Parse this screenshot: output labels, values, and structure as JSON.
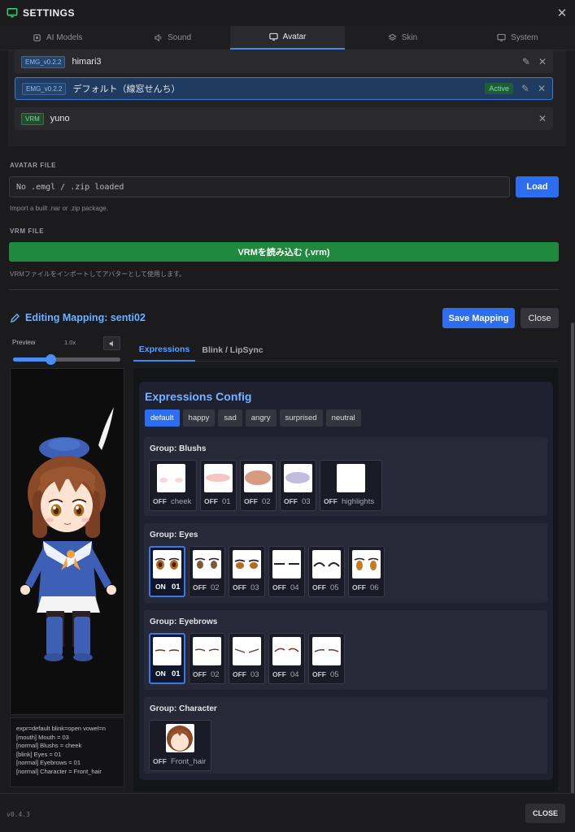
{
  "window": {
    "title": "SETTINGS"
  },
  "tabs": [
    {
      "label": "AI Models",
      "icon": "chip-icon"
    },
    {
      "label": "Sound",
      "icon": "speaker-icon"
    },
    {
      "label": "Avatar",
      "icon": "monitor-icon",
      "active": true
    },
    {
      "label": "Skin",
      "icon": "layers-icon"
    },
    {
      "label": "System",
      "icon": "monitor-icon"
    }
  ],
  "avatars": [
    {
      "badge": "EMG_v0.2.2",
      "name": "himari3"
    },
    {
      "badge": "EMG_v0.2.2",
      "name": "デフォルト（線窓せんち）",
      "status": "Active"
    },
    {
      "badge": "VRM",
      "name": "yuno"
    }
  ],
  "avatar_file": {
    "label": "AVATAR FILE",
    "placeholder": "No .emgl / .zip loaded",
    "load_label": "Load",
    "hint": "Import a built .nar or .zip package."
  },
  "vrm_file": {
    "label": "VRM FILE",
    "button_label": "VRMを読み込む (.vrm)",
    "hint": "VRMファイルをインポートしてアバターとして使用します。"
  },
  "editing": {
    "title": "Editing Mapping: senti02",
    "save_label": "Save Mapping",
    "close_label": "Close"
  },
  "preview": {
    "label": "Preview",
    "speed": "1.0x",
    "slider_value": 0.35,
    "debug_lines": [
      "expr=default blink=open vowel=n",
      "[mouth] Mouth = 03",
      "[normal] Blushs = cheek",
      "[blink] Eyes = 01",
      "[normal] Eyebrows = 01",
      "[normal] Character = Front_hair"
    ]
  },
  "subtabs": [
    {
      "label": "Expressions",
      "active": true
    },
    {
      "label": "Blink / LipSync"
    }
  ],
  "expressions": {
    "title": "Expressions Config",
    "presets": [
      {
        "label": "default",
        "active": true
      },
      {
        "label": "happy"
      },
      {
        "label": "sad"
      },
      {
        "label": "angry"
      },
      {
        "label": "surprised"
      },
      {
        "label": "neutral"
      }
    ],
    "groups": [
      {
        "title": "Group: Blushs",
        "items": [
          {
            "state": "OFF",
            "name": "cheek"
          },
          {
            "state": "OFF",
            "name": "01"
          },
          {
            "state": "OFF",
            "name": "02"
          },
          {
            "state": "OFF",
            "name": "03"
          },
          {
            "state": "OFF",
            "name": "highlights"
          }
        ]
      },
      {
        "title": "Group: Eyes",
        "items": [
          {
            "state": "ON",
            "name": "01"
          },
          {
            "state": "OFF",
            "name": "02"
          },
          {
            "state": "OFF",
            "name": "03"
          },
          {
            "state": "OFF",
            "name": "04"
          },
          {
            "state": "OFF",
            "name": "05"
          },
          {
            "state": "OFF",
            "name": "06"
          }
        ]
      },
      {
        "title": "Group: Eyebrows",
        "items": [
          {
            "state": "ON",
            "name": "01"
          },
          {
            "state": "OFF",
            "name": "02"
          },
          {
            "state": "OFF",
            "name": "03"
          },
          {
            "state": "OFF",
            "name": "04"
          },
          {
            "state": "OFF",
            "name": "05"
          }
        ]
      },
      {
        "title": "Group: Character",
        "items": [
          {
            "state": "OFF",
            "name": "Front_hair"
          }
        ]
      }
    ]
  },
  "footer": {
    "version": "v0.4.3",
    "close_label": "CLOSE"
  },
  "colors": {
    "accent": "#2d6ef0",
    "success": "#1f8a3e",
    "background": "#1b1b1e"
  }
}
